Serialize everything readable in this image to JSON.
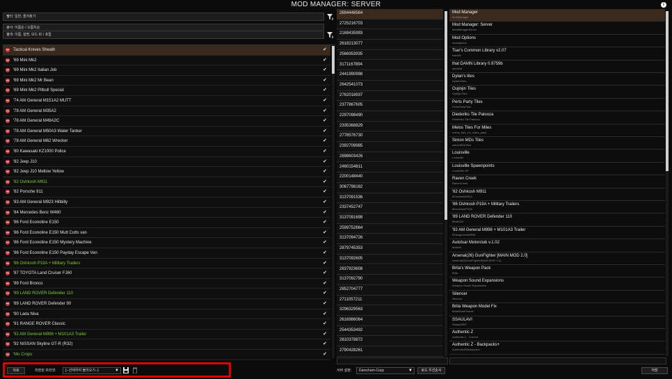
{
  "title": "MOD MANAGER: SERVER",
  "filters": [
    {
      "label": "필터: 일반, 즐겨찾기"
    },
    {
      "label": "순서: 이름순 / 오름차순"
    },
    {
      "label": "검색: 이름, 설명, 모드 ID / 포함"
    }
  ],
  "mods": [
    {
      "name": "Tactical Knives Sheath",
      "green": false,
      "selected": true
    },
    {
      "name": "'69 Mini Mk2",
      "green": false
    },
    {
      "name": "'69 Mini Mk2 Italian Job",
      "green": false
    },
    {
      "name": "'69 Mini Mk2 Mr Bean",
      "green": false
    },
    {
      "name": "'69 Mini Mk2 Pitbull Special",
      "green": false
    },
    {
      "name": "'74 AM General M151A2 MUTT",
      "green": false
    },
    {
      "name": "'78 AM General M35A2",
      "green": false
    },
    {
      "name": "'78 AM General M49A2C",
      "green": false
    },
    {
      "name": "'78 AM General M50A3 Water Tanker",
      "green": false
    },
    {
      "name": "'78 AM General M62 Wrecker",
      "green": false
    },
    {
      "name": "'80 Kawasaki KZ1000 Police",
      "green": false
    },
    {
      "name": "'82 Jeep J10",
      "green": false
    },
    {
      "name": "'82 Jeep J10 Mellow Yellow",
      "green": false
    },
    {
      "name": "'82 Oshkosh M911",
      "green": true
    },
    {
      "name": "'82 Porsche 911",
      "green": false
    },
    {
      "name": "'83 AM General M923 Hillbilly",
      "green": false
    },
    {
      "name": "'84 Mercedes Benz W460",
      "green": false
    },
    {
      "name": "'86 Ford Econoline E150",
      "green": false
    },
    {
      "name": "'86 Ford Econoline E150 Mutt Cutts van",
      "green": false
    },
    {
      "name": "'86 Ford Econoline E150 Mystery Machine",
      "green": false
    },
    {
      "name": "'86 Ford Econoline E150 Payday Escape Van",
      "green": false
    },
    {
      "name": "'86 Oshkosh P19A + Military Trailers",
      "green": true
    },
    {
      "name": "'87 TOYOTA Land Cruiser FJ60",
      "green": false
    },
    {
      "name": "'89 Ford Bronco",
      "green": false
    },
    {
      "name": "'89 LAND ROVER Defender 110",
      "green": true
    },
    {
      "name": "'89 LAND ROVER Defender 90",
      "green": false
    },
    {
      "name": "'90 Lada Niva",
      "green": false
    },
    {
      "name": "'91 RANGE ROVER Classic",
      "green": false
    },
    {
      "name": "'92 AM General M998 + M101A3 Trailer",
      "green": true
    },
    {
      "name": "'92 NISSAN Skyline GT-R (R32)",
      "green": false
    },
    {
      "name": "'Mo Crops",
      "green": true
    }
  ],
  "ids": [
    "2694448564",
    "2725216703",
    "2169435993",
    "2618213077",
    "2566953935",
    "3171167894",
    "2441990998",
    "2642541073",
    "2762018937",
    "2377867605",
    "2297098490",
    "2335368829",
    "2778576730",
    "2392709985",
    "2898603426",
    "2460154811",
    "2200148440",
    "3067798182",
    "3137091536",
    "2337452747",
    "3137091698",
    "2599752664",
    "3137094726",
    "2879745353",
    "3137092605",
    "2837923608",
    "3137092790",
    "2852704777",
    "2711057211",
    "3296329563",
    "2616986064",
    "2544353492",
    "2810378872",
    "2790428261"
  ],
  "info": [
    {
      "t": "Mod Manager",
      "s": "ModManager",
      "selected": true
    },
    {
      "t": "Mod Manager: Server",
      "s": "ModManagerServer"
    },
    {
      "t": "Mod Options",
      "s": "modoptions"
    },
    {
      "t": "Tsar's Common Library v2.07",
      "s": "tsarslib"
    },
    {
      "t": "that DAMN Library 0.9759b",
      "s": "damnlib"
    },
    {
      "t": "Dylan's tiles",
      "s": "DylansTiles"
    },
    {
      "t": "Oujinjin Tiles",
      "s": "OujinjinTiles"
    },
    {
      "t": "Perts Party Tiles",
      "s": "PertsPartyTiles"
    },
    {
      "t": "Diederiks Tile Palooza",
      "s": "Diederiks Tile Palooza"
    },
    {
      "t": "Melos Tiles For Miles",
      "s": "melos_tiles_for_miles_pack"
    },
    {
      "t": "Simon MDs Tiles",
      "s": "simonMDsTiles"
    },
    {
      "t": "Louisville",
      "s": "Louisville"
    },
    {
      "t": "Louisville Spawnpoints",
      "s": "LouisVille SP"
    },
    {
      "t": "Raven Creek",
      "s": "RavenCreek"
    },
    {
      "t": "'82 Oshkosh M911",
      "s": "82oshkoshM911"
    },
    {
      "t": "'86 Oshkosh P19A + Military Trailers",
      "s": "86oshkoshP19A"
    },
    {
      "t": "'89 LAND ROVER Defender 110",
      "s": "89def110"
    },
    {
      "t": "'92 AM General M998 + M101A3 Trailer",
      "s": "92amgeneralM998"
    },
    {
      "t": "Autotsar Motorclub v.1.02",
      "s": "amclub"
    },
    {
      "t": "Arsenal(26) GunFighter [MAIN MOD 2.0]",
      "s": "Arsenal(26)GunFighter[MAIN MOD 2.0]"
    },
    {
      "t": "Brita's Weapon Pack",
      "s": "Brita"
    },
    {
      "t": "Weapon Sound Expansions",
      "s": "Weapon Sound Expansions"
    },
    {
      "t": "Silencer",
      "s": "Silencer"
    },
    {
      "t": "Brita Weapon Model Fix",
      "s": "BritaModelTweak"
    },
    {
      "t": "SSAULAVI",
      "s": "Sanjay9847"
    },
    {
      "t": "Authentic Z",
      "s": "Authentic Z - Current"
    },
    {
      "t": "Authentic Z - Backpacks+",
      "s": "AuthenticZBackpacks+"
    }
  ],
  "bottom": {
    "back_label": "뒤로",
    "preset_label": "저장된 프리셋:",
    "preset_value": "[--선택하여 불러오기--]",
    "server_label": "서버 설정:",
    "server_value": "Damcham-Copy",
    "load_order_label": "로드 우선순서",
    "save_label": "저장"
  }
}
